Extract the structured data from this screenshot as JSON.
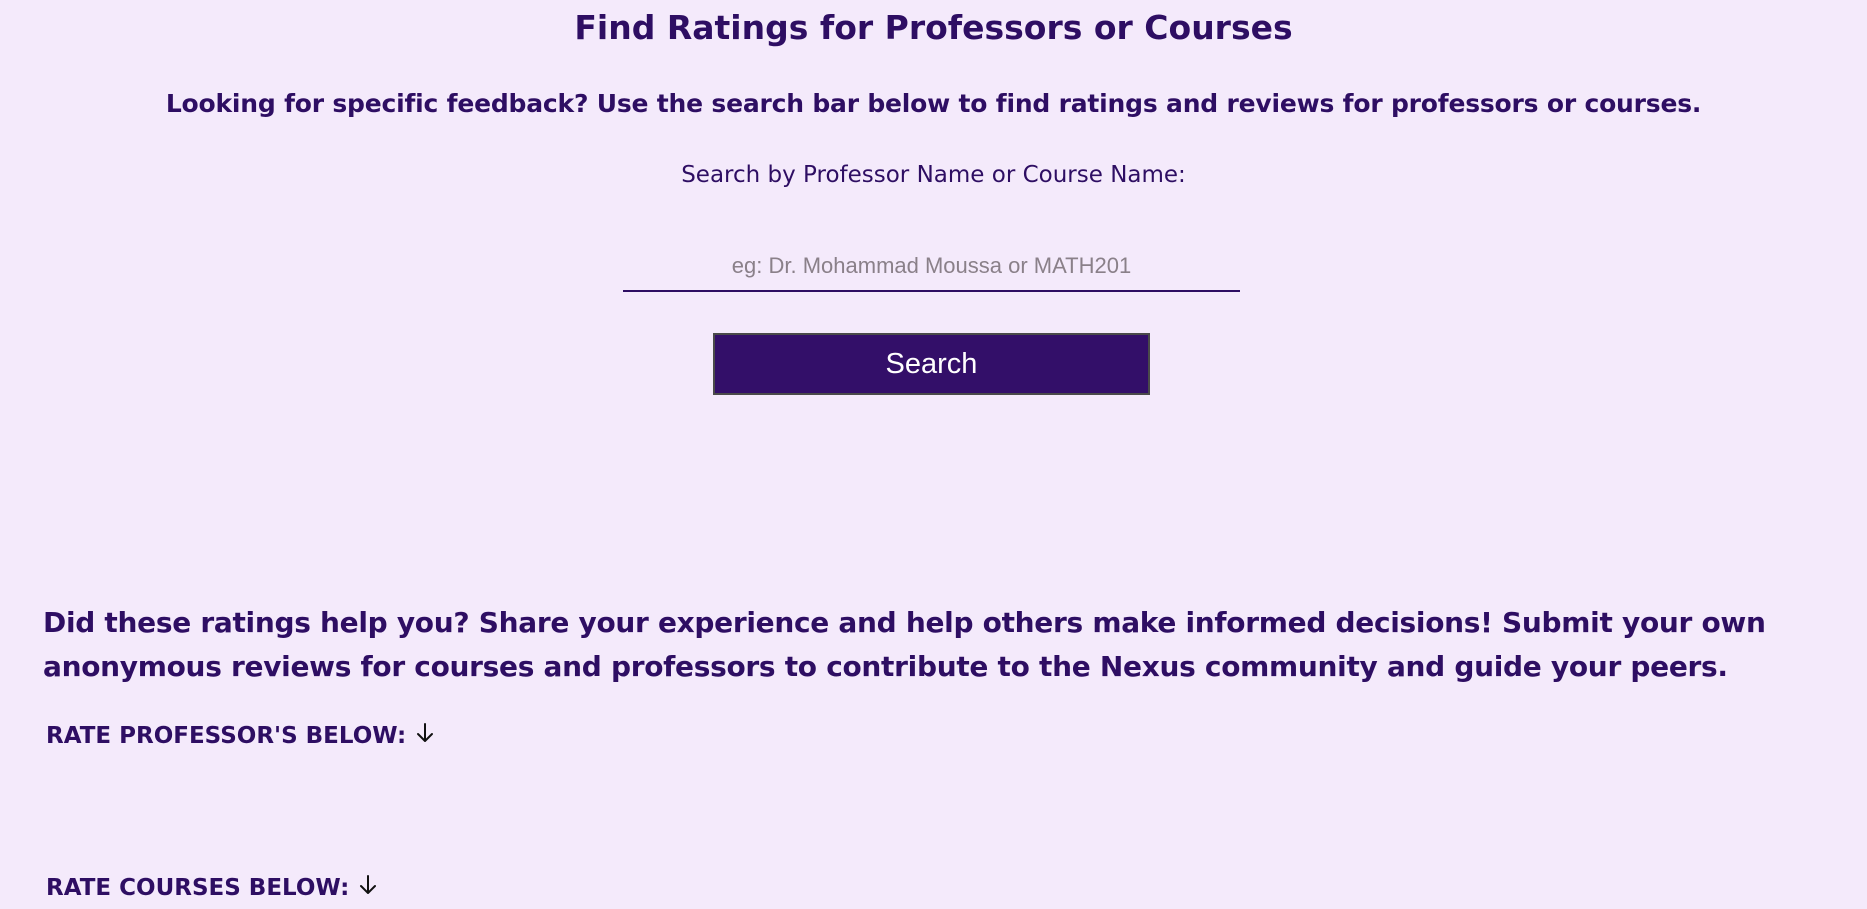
{
  "header": {
    "title": "Find Ratings for Professors or Courses",
    "subtitle": "Looking for specific feedback? Use the search bar below to find ratings and reviews for professors or courses."
  },
  "search": {
    "label": "Search by Professor Name or Course Name:",
    "placeholder": "eg: Dr. Mohammad Moussa or MATH201",
    "value": "",
    "button_label": "Search"
  },
  "contribute": {
    "text": "Did these ratings help you? Share your experience and help others make informed decisions! Submit your own anonymous reviews for courses and professors to contribute to the Nexus community and guide your peers.",
    "rate_professors_label": "RATE PROFESSOR'S BELOW:",
    "rate_courses_label": "RATE COURSES BELOW:",
    "arrow_icon": "arrow-down-icon"
  },
  "colors": {
    "background": "#f4eafb",
    "text": "#2e0e63",
    "button": "#330f69",
    "button_text": "#ffffff"
  }
}
